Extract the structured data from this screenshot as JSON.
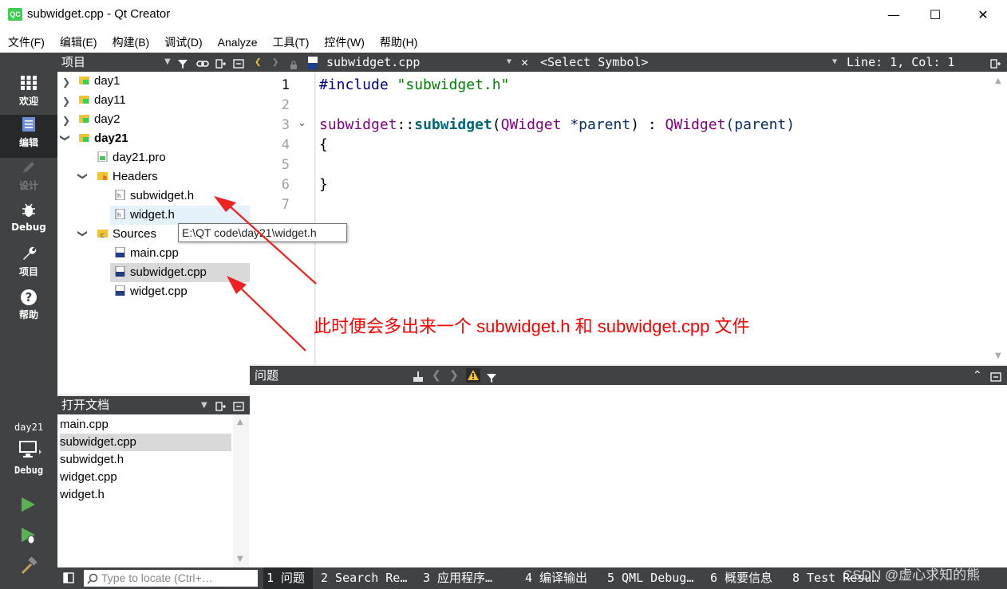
{
  "window": {
    "title": "subwidget.cpp - Qt Creator",
    "app_icon": "QC",
    "minimize": "—",
    "maximize": "☐",
    "close": "✕"
  },
  "menu": [
    "文件(F)",
    "编辑(E)",
    "构建(B)",
    "调试(D)",
    "Analyze",
    "工具(T)",
    "控件(W)",
    "帮助(H)"
  ],
  "modes": [
    {
      "label": "欢迎",
      "icon": "grid-icon"
    },
    {
      "label": "编辑",
      "icon": "document-icon"
    },
    {
      "label": "设计",
      "icon": "pencil-icon"
    },
    {
      "label": "Debug",
      "icon": "bug-icon"
    },
    {
      "label": "项目",
      "icon": "wrench-icon"
    },
    {
      "label": "帮助",
      "icon": "help-icon"
    }
  ],
  "kit": {
    "project": "day21",
    "config": "Debug"
  },
  "project_panel": {
    "title": "项目"
  },
  "tree": [
    {
      "label": "day1",
      "type": "project",
      "expanded": false
    },
    {
      "label": "day11",
      "type": "project",
      "expanded": false
    },
    {
      "label": "day2",
      "type": "project",
      "expanded": false
    },
    {
      "label": "day21",
      "type": "project",
      "expanded": true,
      "bold": true
    },
    {
      "label": "day21.pro",
      "type": "pro"
    },
    {
      "label": "Headers",
      "type": "folder-h",
      "expanded": true
    },
    {
      "label": "subwidget.h",
      "type": "header"
    },
    {
      "label": "widget.h",
      "type": "header",
      "hovered": true
    },
    {
      "label": "Sources",
      "type": "folder-cpp",
      "expanded": true
    },
    {
      "label": "main.cpp",
      "type": "cpp"
    },
    {
      "label": "subwidget.cpp",
      "type": "cpp",
      "selected": true
    },
    {
      "label": "widget.cpp",
      "type": "cpp"
    }
  ],
  "tooltip": "E:\\QT code\\day21\\widget.h",
  "open_docs": {
    "title": "打开文档",
    "items": [
      "main.cpp",
      "subwidget.cpp",
      "subwidget.h",
      "widget.cpp",
      "widget.h"
    ],
    "selected": "subwidget.cpp"
  },
  "editor": {
    "filename": "subwidget.cpp",
    "symbol": "<Select Symbol>",
    "position": "Line: 1, Col: 1",
    "line_numbers": [
      "1",
      "2",
      "3",
      "4",
      "5",
      "6",
      "7"
    ],
    "code": {
      "l1_directive": "#include",
      "l1_string": "\"subwidget.h\"",
      "l3_class": "subwidget",
      "l3_sep": "::",
      "l3_func": "subwidget",
      "l3_paren": "(",
      "l3_type": "QWidget",
      "l3_param": " *parent",
      "l3_close": ") : ",
      "l3_base": "QWidget",
      "l3_args": "(parent)",
      "l4": "{",
      "l6": "}"
    }
  },
  "issues": {
    "title": "问题"
  },
  "statusbar": {
    "locator_placeholder": "Type to locate (Ctrl+…",
    "tabs": [
      "1 问题",
      "2 Search Re…",
      "3 应用程序…",
      "4 编译输出",
      "5 QML Debug…",
      "6 概要信息",
      "8 Test Resu…"
    ]
  },
  "annotation": "此时便会多出来一个 subwidget.h 和 subwidget.cpp 文件",
  "watermark": "CSDN @虚心求知的熊",
  "colors": {
    "dark_panel": "#404244",
    "keyword": "#808000",
    "string": "#008000",
    "class": "#800080",
    "func": "#00677c",
    "annotation": "#ff0000"
  }
}
